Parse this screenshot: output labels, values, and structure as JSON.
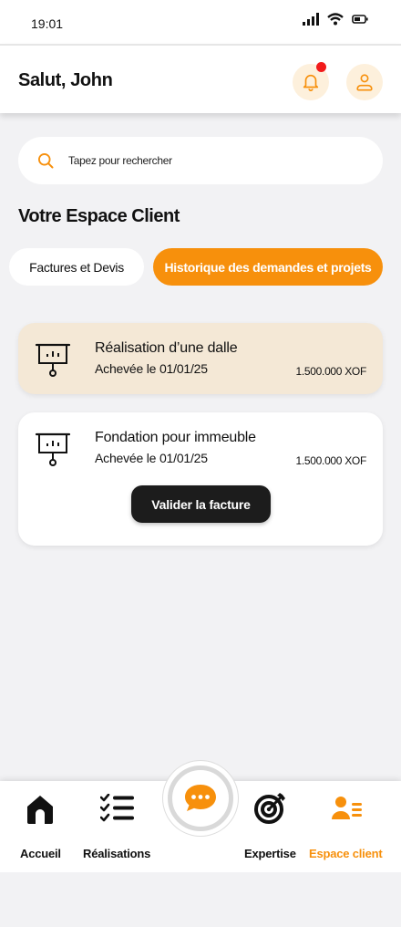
{
  "status": {
    "time": "19:01"
  },
  "header": {
    "greeting": "Salut, John"
  },
  "search": {
    "placeholder": "Tapez pour rechercher"
  },
  "section": {
    "title": "Votre Espace Client"
  },
  "tabs": [
    {
      "label": "Factures et Devis",
      "active": false
    },
    {
      "label": "Historique des demandes et projets",
      "active": true
    }
  ],
  "projects": [
    {
      "title": "Réalisation d’une dalle",
      "status": "Achevée le 01/01/25",
      "amount": "1.500.000 XOF",
      "icon": "presentation-board-icon"
    },
    {
      "title": "Fondation pour immeuble",
      "status": "Achevée le 01/01/25",
      "amount": "1.500.000 XOF",
      "icon": "presentation-board-icon",
      "action": "Valider la facture"
    }
  ],
  "nav": {
    "items": [
      {
        "label": "Accueil",
        "icon": "home-icon"
      },
      {
        "label": "Réalisations",
        "icon": "checklist-icon"
      },
      {
        "label": "Expertise",
        "icon": "target-icon"
      },
      {
        "label": "Espace client",
        "icon": "user-list-icon",
        "active": true
      }
    ],
    "center": {
      "icon": "chat-icon"
    }
  },
  "colors": {
    "accent": "#f7900c",
    "accent_soft": "#fdf0dc",
    "card_highlight": "#f4e8d6",
    "dark_button": "#1c1c1c",
    "notification": "#f21b1b"
  }
}
